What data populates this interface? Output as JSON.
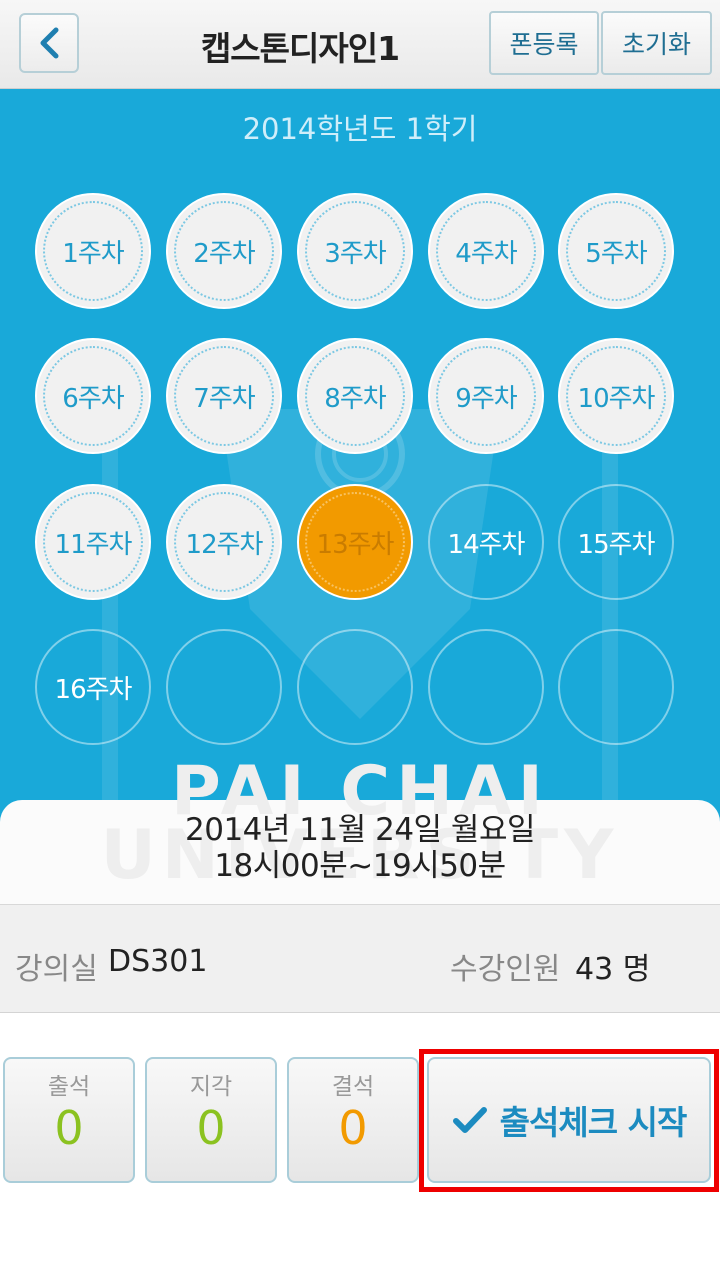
{
  "header": {
    "back_icon": "chevron-left-icon",
    "title": "캡스톤디자인1",
    "font_register_label": "폰등록",
    "reset_label": "초기화"
  },
  "semester": "2014학년도 1학기",
  "watermark": {
    "line1": "PAI CHAI",
    "line2": "UNIVERSITY"
  },
  "weeks": [
    {
      "label": "1주차",
      "state": "done"
    },
    {
      "label": "2주차",
      "state": "done"
    },
    {
      "label": "3주차",
      "state": "done"
    },
    {
      "label": "4주차",
      "state": "done"
    },
    {
      "label": "5주차",
      "state": "done"
    },
    {
      "label": "6주차",
      "state": "done"
    },
    {
      "label": "7주차",
      "state": "done"
    },
    {
      "label": "8주차",
      "state": "done"
    },
    {
      "label": "9주차",
      "state": "done"
    },
    {
      "label": "10주차",
      "state": "done"
    },
    {
      "label": "11주차",
      "state": "done"
    },
    {
      "label": "12주차",
      "state": "done"
    },
    {
      "label": "13주차",
      "state": "current"
    },
    {
      "label": "14주차",
      "state": "future"
    },
    {
      "label": "15주차",
      "state": "future"
    },
    {
      "label": "16주차",
      "state": "future"
    },
    {
      "label": "",
      "state": "empty"
    },
    {
      "label": "",
      "state": "empty"
    },
    {
      "label": "",
      "state": "empty"
    },
    {
      "label": "",
      "state": "empty"
    }
  ],
  "session": {
    "date": "2014년 11월 24일 월요일",
    "time": "18시00분~19시50분"
  },
  "info": {
    "room_label": "강의실",
    "room_value": "DS301",
    "capacity_label": "수강인원",
    "capacity_value": "43 명"
  },
  "stats": {
    "attend_label": "출석",
    "attend_value": "0",
    "late_label": "지각",
    "late_value": "0",
    "absent_label": "결석",
    "absent_value": "0"
  },
  "start_button": {
    "icon": "checkmark-icon",
    "label": "출석체크 시작"
  },
  "colors": {
    "blue_bg": "#19a9d9",
    "current_week": "#f29a00",
    "attend": "#8bc220",
    "late": "#8bc220",
    "absent": "#f29a00",
    "accent_text": "#1c8bc0",
    "highlight": "#ee0000"
  }
}
